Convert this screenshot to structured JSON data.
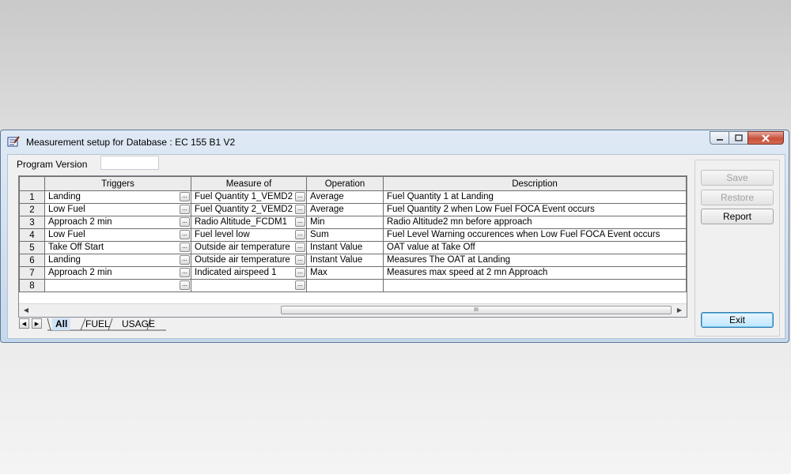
{
  "window": {
    "title": "Measurement setup for Database : EC 155 B1 V2"
  },
  "program_version": {
    "label": "Program Version",
    "value": ""
  },
  "grid": {
    "columns": [
      "Triggers",
      "Measure of",
      "Operation",
      "Description"
    ],
    "rows": [
      {
        "num": "1",
        "trigger": "Landing",
        "measure": "Fuel Quantity 1_VEMD2",
        "operation": "Average",
        "description": "Fuel Quantity 1 at Landing"
      },
      {
        "num": "2",
        "trigger": "Low Fuel",
        "measure": "Fuel Quantity 2_VEMD2",
        "operation": "Average",
        "description": "Fuel Quantity 2 when Low Fuel FOCA Event occurs"
      },
      {
        "num": "3",
        "trigger": "Approach 2 min",
        "measure": "Radio Altitude_FCDM1",
        "operation": "Min",
        "description": "Radio Altitude2 mn before approach"
      },
      {
        "num": "4",
        "trigger": "Low Fuel",
        "measure": "Fuel level low",
        "operation": "Sum",
        "description": "Fuel Level Warning occurences when Low Fuel FOCA Event occurs"
      },
      {
        "num": "5",
        "trigger": "Take Off Start",
        "measure": "Outside air temperature",
        "operation": "Instant Value",
        "description": "OAT value at Take Off"
      },
      {
        "num": "6",
        "trigger": "Landing",
        "measure": "Outside air temperature",
        "operation": "Instant Value",
        "description": "Measures The OAT at Landing"
      },
      {
        "num": "7",
        "trigger": "Approach 2 min",
        "measure": "Indicated airspeed 1",
        "operation": "Max",
        "description": "Measures max speed at 2 mn Approach"
      },
      {
        "num": "8",
        "trigger": "",
        "measure": "",
        "operation": "",
        "description": ""
      }
    ],
    "ellipsis": "...",
    "thumb_grip": "III"
  },
  "tabs": [
    "All",
    "FUEL",
    "USAGE"
  ],
  "active_tab": "All",
  "buttons": {
    "save": "Save",
    "restore": "Restore",
    "report": "Report",
    "exit": "Exit"
  },
  "icons": [
    "app-notepad-icon",
    "minimize-icon",
    "maximize-icon",
    "close-icon",
    "scroll-left-icon",
    "scroll-right-icon",
    "tab-prev-icon",
    "tab-next-icon"
  ]
}
